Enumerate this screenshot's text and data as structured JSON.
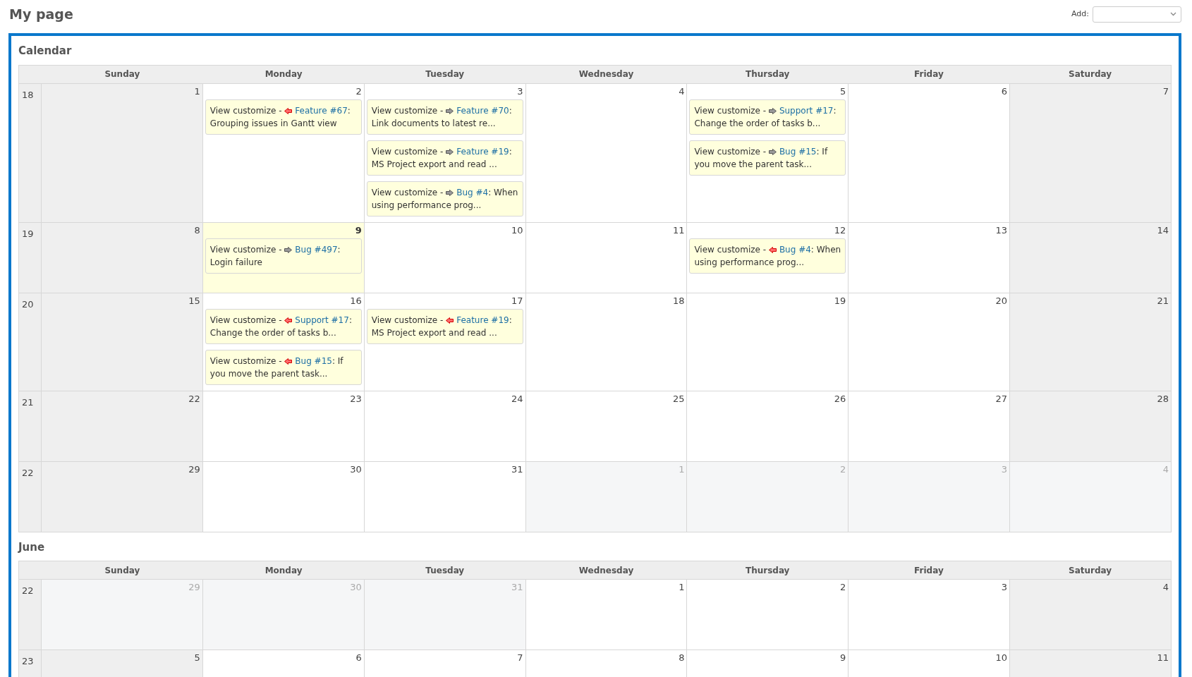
{
  "page_title": "My page",
  "add": {
    "label": "Add:"
  },
  "calendars": [
    {
      "title": "Calendar",
      "weekdays": [
        "Sunday",
        "Monday",
        "Tuesday",
        "Wednesday",
        "Thursday",
        "Friday",
        "Saturday"
      ],
      "weeks": [
        {
          "number": "18",
          "days": [
            {
              "day": "1",
              "kind": "current"
            },
            {
              "day": "2",
              "kind": "current",
              "events": [
                {
                  "prefix": "View customize - ",
                  "kind": "end",
                  "link": "Feature #67",
                  "rest": ": Grouping issues in Gantt view"
                }
              ]
            },
            {
              "day": "3",
              "kind": "current",
              "events": [
                {
                  "prefix": "View customize - ",
                  "kind": "start",
                  "link": "Feature #70",
                  "rest": ": Link documents to latest re..."
                },
                {
                  "prefix": "View customize - ",
                  "kind": "start",
                  "link": "Feature #19",
                  "rest": ": MS Project export and read ..."
                },
                {
                  "prefix": "View customize - ",
                  "kind": "start",
                  "link": "Bug #4",
                  "rest": ": When using performance prog..."
                }
              ]
            },
            {
              "day": "4",
              "kind": "current"
            },
            {
              "day": "5",
              "kind": "current",
              "events": [
                {
                  "prefix": "View customize - ",
                  "kind": "start",
                  "link": "Support #17",
                  "rest": ": Change the order of tasks b..."
                },
                {
                  "prefix": "View customize - ",
                  "kind": "start",
                  "link": "Bug #15",
                  "rest": ": If you move the parent task..."
                }
              ]
            },
            {
              "day": "6",
              "kind": "current"
            },
            {
              "day": "7",
              "kind": "current"
            }
          ]
        },
        {
          "number": "19",
          "days": [
            {
              "day": "8",
              "kind": "current"
            },
            {
              "day": "9",
              "kind": "today",
              "events": [
                {
                  "prefix": "View customize - ",
                  "kind": "start",
                  "link": "Bug #497",
                  "rest": ": Login failure"
                }
              ]
            },
            {
              "day": "10",
              "kind": "current"
            },
            {
              "day": "11",
              "kind": "current"
            },
            {
              "day": "12",
              "kind": "current",
              "events": [
                {
                  "prefix": "View customize - ",
                  "kind": "end",
                  "link": "Bug #4",
                  "rest": ": When using performance prog..."
                }
              ]
            },
            {
              "day": "13",
              "kind": "current"
            },
            {
              "day": "14",
              "kind": "current"
            }
          ]
        },
        {
          "number": "20",
          "days": [
            {
              "day": "15",
              "kind": "current"
            },
            {
              "day": "16",
              "kind": "current",
              "events": [
                {
                  "prefix": "View customize - ",
                  "kind": "end",
                  "link": "Support #17",
                  "rest": ": Change the order of tasks b..."
                },
                {
                  "prefix": "View customize - ",
                  "kind": "end",
                  "link": "Bug #15",
                  "rest": ": If you move the parent task..."
                }
              ]
            },
            {
              "day": "17",
              "kind": "current",
              "events": [
                {
                  "prefix": "View customize - ",
                  "kind": "end",
                  "link": "Feature #19",
                  "rest": ": MS Project export and read ..."
                }
              ]
            },
            {
              "day": "18",
              "kind": "current"
            },
            {
              "day": "19",
              "kind": "current"
            },
            {
              "day": "20",
              "kind": "current"
            },
            {
              "day": "21",
              "kind": "current"
            }
          ]
        },
        {
          "number": "21",
          "days": [
            {
              "day": "22",
              "kind": "current"
            },
            {
              "day": "23",
              "kind": "current"
            },
            {
              "day": "24",
              "kind": "current"
            },
            {
              "day": "25",
              "kind": "current"
            },
            {
              "day": "26",
              "kind": "current"
            },
            {
              "day": "27",
              "kind": "current"
            },
            {
              "day": "28",
              "kind": "current"
            }
          ]
        },
        {
          "number": "22",
          "days": [
            {
              "day": "29",
              "kind": "current"
            },
            {
              "day": "30",
              "kind": "current"
            },
            {
              "day": "31",
              "kind": "current"
            },
            {
              "day": "1",
              "kind": "other"
            },
            {
              "day": "2",
              "kind": "other"
            },
            {
              "day": "3",
              "kind": "other"
            },
            {
              "day": "4",
              "kind": "other"
            }
          ]
        }
      ]
    },
    {
      "title": "June",
      "weekdays": [
        "Sunday",
        "Monday",
        "Tuesday",
        "Wednesday",
        "Thursday",
        "Friday",
        "Saturday"
      ],
      "weeks": [
        {
          "number": "22",
          "days": [
            {
              "day": "29",
              "kind": "other"
            },
            {
              "day": "30",
              "kind": "other"
            },
            {
              "day": "31",
              "kind": "other"
            },
            {
              "day": "1",
              "kind": "current"
            },
            {
              "day": "2",
              "kind": "current"
            },
            {
              "day": "3",
              "kind": "current"
            },
            {
              "day": "4",
              "kind": "current"
            }
          ]
        },
        {
          "number": "23",
          "days": [
            {
              "day": "5",
              "kind": "current"
            },
            {
              "day": "6",
              "kind": "current"
            },
            {
              "day": "7",
              "kind": "current"
            },
            {
              "day": "8",
              "kind": "current"
            },
            {
              "day": "9",
              "kind": "current"
            },
            {
              "day": "10",
              "kind": "current"
            },
            {
              "day": "11",
              "kind": "current"
            }
          ]
        }
      ]
    }
  ]
}
